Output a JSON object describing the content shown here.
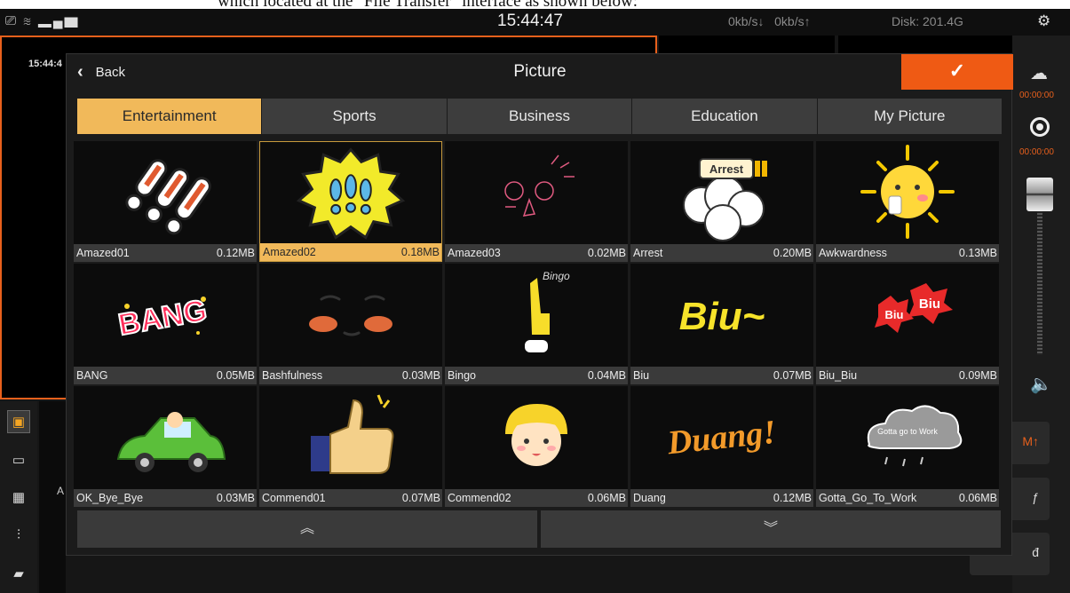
{
  "caption_text": "which located at the \"File Transfer\" interface as shown below:",
  "status": {
    "clock": "15:44:47",
    "net_down": "0kb/s↓",
    "net_up": "0kb/s↑",
    "disk": "Disk: 201.4G",
    "icons": [
      "cast-icon",
      "wifi-icon",
      "signal-icon",
      "gear-icon"
    ]
  },
  "preview": {
    "time": "15:44:4"
  },
  "right_rail": {
    "time_1": "00:00:00",
    "time_2": "00:00:00",
    "icons": [
      "cloud-icon",
      "record-icon",
      "fader-knob",
      "speaker-icon"
    ]
  },
  "side_buttons": [
    "M↑",
    "ƒ",
    "đ"
  ],
  "left_strip_letter": "A",
  "modal": {
    "back_label": "Back",
    "title": "Picture",
    "confirm_icon": "check-icon"
  },
  "tabs": [
    {
      "label": "Entertainment",
      "active": true
    },
    {
      "label": "Sports",
      "active": false
    },
    {
      "label": "Business",
      "active": false
    },
    {
      "label": "Education",
      "active": false
    },
    {
      "label": "My Picture",
      "active": false
    }
  ],
  "pictures": [
    {
      "name": "Amazed01",
      "size": "0.12MB",
      "icon": "exclamation-sticker"
    },
    {
      "name": "Amazed02",
      "size": "0.18MB",
      "icon": "burst-sticker",
      "selected": true
    },
    {
      "name": "Amazed03",
      "size": "0.02MB",
      "icon": "face-sketch-sticker"
    },
    {
      "name": "Arrest",
      "size": "0.20MB",
      "icon": "arrest-sticker",
      "text": "Arrest"
    },
    {
      "name": "Awkwardness",
      "size": "0.13MB",
      "icon": "sun-sticker"
    },
    {
      "name": "BANG",
      "size": "0.05MB",
      "icon": "bang-sticker",
      "text": "BANG"
    },
    {
      "name": "Bashfulness",
      "size": "0.03MB",
      "icon": "blush-sticker"
    },
    {
      "name": "Bingo",
      "size": "0.04MB",
      "icon": "bingo-sticker",
      "text": "Bingo"
    },
    {
      "name": "Biu",
      "size": "0.07MB",
      "icon": "biu-sticker",
      "text": "Biu~"
    },
    {
      "name": "Biu_Biu",
      "size": "0.09MB",
      "icon": "biu-biu-sticker",
      "text": "Biu"
    },
    {
      "name": "OK_Bye_Bye",
      "size": "0.03MB",
      "icon": "car-sticker"
    },
    {
      "name": "Commend01",
      "size": "0.07MB",
      "icon": "thumbs-up-sticker"
    },
    {
      "name": "Commend02",
      "size": "0.06MB",
      "icon": "girl-sticker"
    },
    {
      "name": "Duang",
      "size": "0.12MB",
      "icon": "duang-sticker",
      "text": "Duang!"
    },
    {
      "name": "Gotta_Go_To_Work",
      "size": "0.06MB",
      "icon": "cloud-sticker",
      "text": "Gotta go to Work"
    }
  ],
  "pager": {
    "up_icon": "double-chevron-up-icon",
    "down_icon": "double-chevron-down-icon"
  },
  "colors": {
    "accent": "#ef5a14",
    "tab_active": "#f1b95a",
    "preview_border": "#e8601c"
  }
}
